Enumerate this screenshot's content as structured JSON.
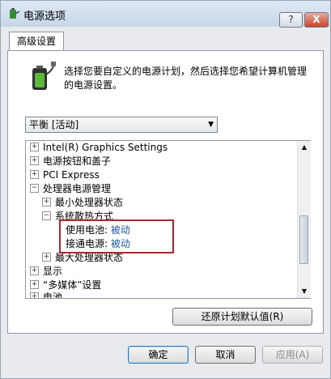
{
  "window": {
    "title": "电源选项",
    "help_label": "?",
    "close_label": "X"
  },
  "tab": {
    "label": "高级设置"
  },
  "description": "选择您要自定义的电源计划，然后选择您希望计算机管理的电源设置。",
  "plan_select": {
    "value": "平衡 [活动]"
  },
  "tree": {
    "items": [
      {
        "expander": "+",
        "label": "Intel(R) Graphics Settings"
      },
      {
        "expander": "+",
        "label": "电源按钮和盖子"
      },
      {
        "expander": "+",
        "label": "PCI Express"
      },
      {
        "expander": "−",
        "label": "处理器电源管理"
      },
      {
        "expander": "+",
        "label": "最小处理器状态"
      },
      {
        "expander": "−",
        "label": "系统散热方式"
      },
      {
        "label": "使用电池:",
        "value": "被动"
      },
      {
        "label": "接通电源:",
        "value": "被动"
      },
      {
        "expander": "+",
        "label": "最大处理器状态"
      },
      {
        "expander": "+",
        "label": "显示"
      },
      {
        "expander": "+",
        "label": "“多媒体”设置"
      },
      {
        "expander": "+",
        "label": "电池"
      }
    ]
  },
  "buttons": {
    "restore": "还原计划默认值(R)",
    "ok": "确定",
    "cancel": "取消",
    "apply": "应用(A)"
  },
  "colors": {
    "value_link": "#1e5aa8",
    "highlight_box": "#b3262e"
  }
}
